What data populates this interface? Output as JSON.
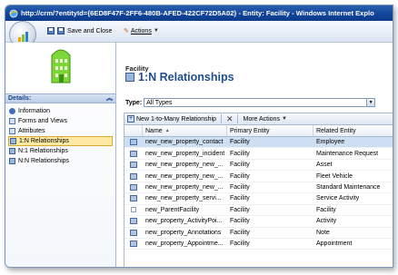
{
  "window": {
    "title": "http://crm/?entityId={6ED8F47F-2FF6-480B-AFED-422CF72D5A02} - Entity: Facility - Windows Internet Explo"
  },
  "toolbar": {
    "save_close_label": "Save and Close",
    "actions_label": "Actions"
  },
  "nav": {
    "section_title": "Details:",
    "items": [
      {
        "label": "Information"
      },
      {
        "label": "Forms and Views"
      },
      {
        "label": "Attributes"
      },
      {
        "label": "1:N Relationships"
      },
      {
        "label": "N:1 Relationships"
      },
      {
        "label": "N:N Relationships"
      }
    ]
  },
  "main": {
    "entity_name": "Facility",
    "page_title": "1:N Relationships",
    "type_label": "Type:",
    "type_value": "All Types",
    "new_button": "New 1-to-Many Relationship",
    "more_actions": "More Actions",
    "columns": {
      "name": "Name",
      "primary": "Primary Entity",
      "related": "Related Entity"
    },
    "rows": [
      {
        "name": "new_new_property_contact",
        "primary": "Facility",
        "related": "Employee"
      },
      {
        "name": "new_new_property_incident",
        "primary": "Facility",
        "related": "Maintenance Request"
      },
      {
        "name": "new_new_property_new_...",
        "primary": "Facility",
        "related": "Asset"
      },
      {
        "name": "new_new_property_new_...",
        "primary": "Facility",
        "related": "Fleet Vehicle"
      },
      {
        "name": "new_new_property_new_...",
        "primary": "Facility",
        "related": "Standard Maintenance"
      },
      {
        "name": "new_new_property_servi...",
        "primary": "Facility",
        "related": "Service Activity"
      },
      {
        "name": "new_ParentFacility",
        "primary": "Facility",
        "related": "Facility"
      },
      {
        "name": "new_property_ActivityPoi...",
        "primary": "Facility",
        "related": "Activity"
      },
      {
        "name": "new_property_Annotations",
        "primary": "Facility",
        "related": "Note"
      },
      {
        "name": "new_property_Appointme...",
        "primary": "Facility",
        "related": "Appointment"
      }
    ]
  }
}
